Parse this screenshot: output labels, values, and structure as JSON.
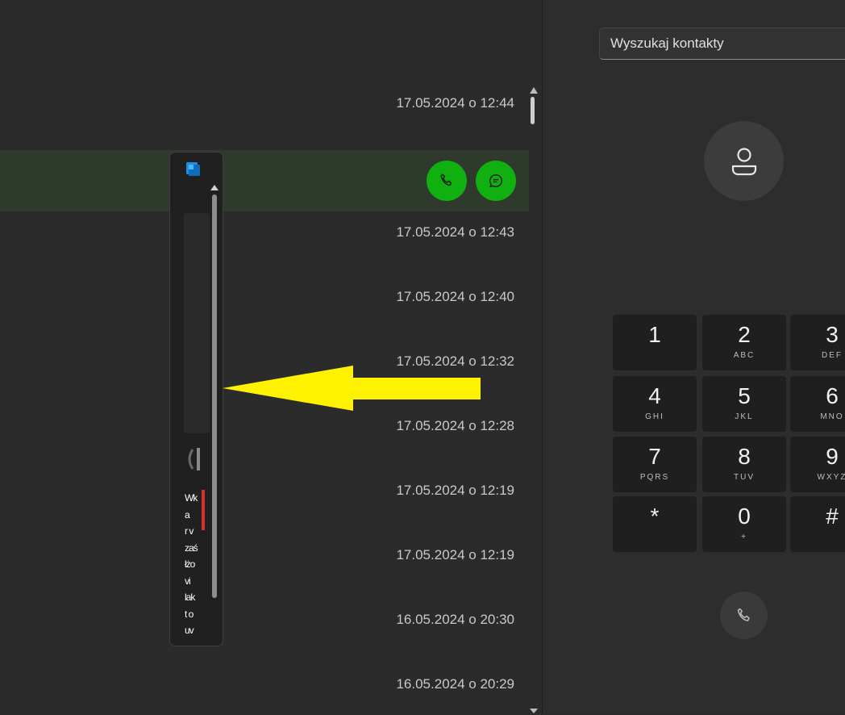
{
  "history": {
    "rows": [
      {
        "timestamp": "17.05.2024 o 12:44"
      },
      {
        "timestamp": ""
      },
      {
        "timestamp": "17.05.2024 o 12:43"
      },
      {
        "timestamp": "17.05.2024 o 12:40"
      },
      {
        "timestamp": "17.05.2024 o 12:32"
      },
      {
        "timestamp": "17.05.2024 o 12:28"
      },
      {
        "timestamp": "17.05.2024 o 12:19"
      },
      {
        "timestamp": "17.05.2024 o 12:19"
      },
      {
        "timestamp": "16.05.2024 o 20:30"
      },
      {
        "timestamp": "16.05.2024 o 20:29"
      }
    ],
    "selected_row_actions": [
      "phone-icon",
      "message-icon"
    ]
  },
  "search": {
    "placeholder": "Wyszukaj kontakty"
  },
  "keypad": {
    "keys": [
      {
        "digit": "1",
        "letters": ""
      },
      {
        "digit": "2",
        "letters": "ABC"
      },
      {
        "digit": "3",
        "letters": "DEF"
      },
      {
        "digit": "4",
        "letters": "GHI"
      },
      {
        "digit": "5",
        "letters": "JKL"
      },
      {
        "digit": "6",
        "letters": "MNO"
      },
      {
        "digit": "7",
        "letters": "PQRS"
      },
      {
        "digit": "8",
        "letters": "TUV"
      },
      {
        "digit": "9",
        "letters": "WXYZ"
      },
      {
        "digit": "*",
        "letters": ""
      },
      {
        "digit": "0",
        "letters": "+"
      },
      {
        "digit": "#",
        "letters": ""
      }
    ]
  },
  "mini_window": {
    "text_fragment": "Wk\na\nr v\nzaś\nłżo\nvi\nlak\nt o\nuv\n:\na"
  },
  "colors": {
    "accent_green": "#10b010",
    "annotation_yellow": "#fff200",
    "background": "#2b2b2b"
  }
}
